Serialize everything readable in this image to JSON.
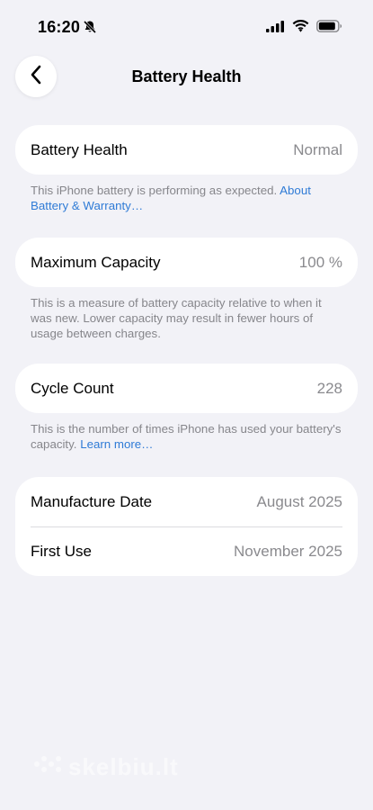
{
  "status_bar": {
    "time": "16:20",
    "bell_icon": "bell-slash-icon",
    "signal_icon": "cellular-signal-icon",
    "wifi_icon": "wifi-icon",
    "battery_icon": "battery-icon"
  },
  "nav": {
    "title": "Battery Health",
    "back_icon": "chevron-left-icon"
  },
  "battery_health": {
    "label": "Battery Health",
    "value": "Normal",
    "footnote": "This iPhone battery is performing as expected. ",
    "link": "About Battery & Warranty…"
  },
  "max_capacity": {
    "label": "Maximum Capacity",
    "value": "100 %",
    "footnote": "This is a measure of battery capacity relative to when it was new. Lower capacity may result in fewer hours of usage between charges."
  },
  "cycle_count": {
    "label": "Cycle Count",
    "value": "228",
    "footnote": "This is the number of times iPhone has used your battery's capacity. ",
    "link": "Learn more…"
  },
  "dates": {
    "manufacture_label": "Manufacture Date",
    "manufacture_value": "August 2025",
    "first_use_label": "First Use",
    "first_use_value": "November 2025"
  },
  "watermark": {
    "text": "skelbiu.lt"
  },
  "colors": {
    "background": "#f2f2f7",
    "card": "#ffffff",
    "link": "#2f7bd6",
    "secondary_text": "#8a8a8e"
  }
}
